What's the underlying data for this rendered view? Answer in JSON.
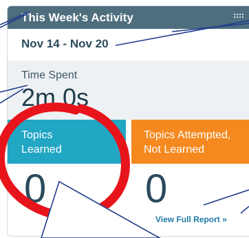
{
  "activity_card": {
    "title": "This Week's Activity",
    "menu_icon": "grip-dots-icon",
    "date_range": "Nov 14 - Nov 20",
    "time_spent": {
      "label": "Time Spent",
      "value": "2m 0s"
    },
    "topics_learned": {
      "label_line1": "Topics",
      "label_line2": "Learned",
      "count": "0"
    },
    "topics_attempted": {
      "label_line1": "Topics Attempted,",
      "label_line2": "Not Learned",
      "count": "0"
    },
    "report_link": "View Full Report »"
  },
  "colors": {
    "header": "#4e6e7e",
    "learned_tile": "#21a6c3",
    "attempted_tile": "#f5891f",
    "annotation_circle": "#e8141b",
    "annotation_lines": "#1f3b8c"
  }
}
